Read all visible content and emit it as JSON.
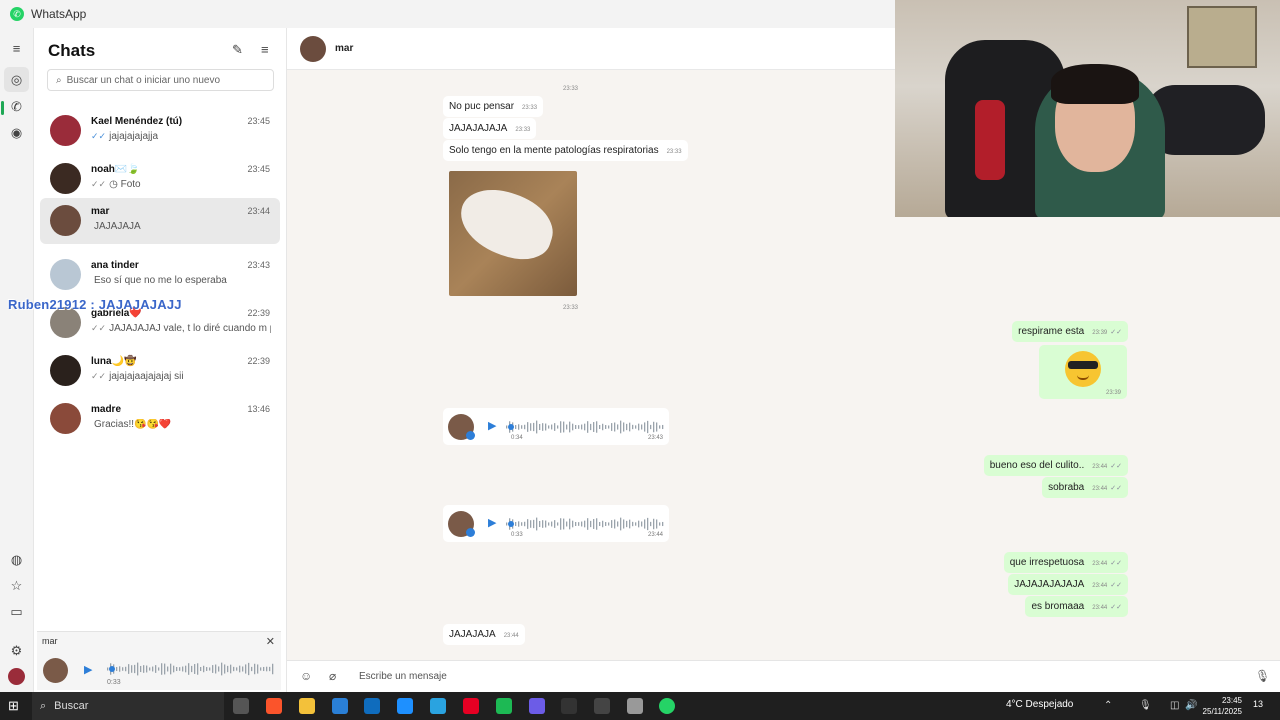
{
  "window": {
    "title": "WhatsApp",
    "logo_glyph": "✆"
  },
  "rail": {
    "icons": [
      "menu-icon",
      "chats-icon",
      "calls-icon",
      "status-icon",
      "communities-icon",
      "starred-icon",
      "archived-icon",
      "settings-icon",
      "profile-avatar"
    ],
    "glyphs": {
      "menu": "≡",
      "chats": "◎",
      "calls": "✆",
      "status": "◉",
      "communities": "◍",
      "starred": "☆",
      "archived": "▭",
      "settings": "⚙"
    },
    "accent": "#1fa855"
  },
  "chat_list": {
    "title": "Chats",
    "new_chat_glyph": "✎",
    "filter_glyph": "≡",
    "search_glyph": "⌕",
    "search_placeholder": "Buscar un chat o iniciar uno nuevo",
    "chats": [
      {
        "name": "Kael Menéndez (tú)",
        "time": "23:45",
        "preview": "jajajajajajja",
        "ticks": "✓✓",
        "avatar_color": "#9a2c3a"
      },
      {
        "name": "noah✉️🍃",
        "time": "23:45",
        "preview": "◷ Foto",
        "ticks": "✓✓",
        "avatar_color": "#3b2a22"
      },
      {
        "name": "mar",
        "time": "23:44",
        "preview": "JAJAJAJA",
        "ticks": "",
        "avatar_color": "#6b4c3e"
      },
      {
        "name": "ana tinder",
        "time": "23:43",
        "preview": "Eso sí que no me lo esperaba",
        "ticks": "",
        "avatar_color": "#b9c7d4"
      },
      {
        "name": "gabriela❤️",
        "time": "22:39",
        "preview": "JAJAJAJAJ vale, t lo diré cuando m p...",
        "ticks": "✓✓",
        "avatar_color": "#8a8278"
      },
      {
        "name": "luna🌙🤠",
        "time": "22:39",
        "preview": "jajajajaajajajaj sii",
        "ticks": "✓✓",
        "avatar_color": "#2a211c"
      },
      {
        "name": "madre",
        "time": "13:46",
        "preview": "Gracias!!😘😘❤️",
        "ticks": "",
        "avatar_color": "#8a4a3a"
      }
    ]
  },
  "overlay_watermark": "Ruben21912 : JAJAJAJAJJ",
  "mini_player": {
    "name": "mar",
    "duration": "0:33",
    "close_glyph": "✕",
    "play_glyph": "▶"
  },
  "conversation": {
    "contact_name": "mar",
    "top_stamp": "23:33",
    "messages": [
      {
        "text": "No puc pensar",
        "time": "23:33",
        "dir": "in"
      },
      {
        "text": "JAJAJAJAJA",
        "time": "23:33",
        "dir": "in"
      },
      {
        "text": "Solo tengo en la mente patologías respiratorias",
        "time": "23:33",
        "dir": "in"
      },
      {
        "text": "respirame esta",
        "time": "23:39",
        "dir": "out"
      },
      {
        "text": "bueno eso del culito..",
        "time": "23:44",
        "dir": "out"
      },
      {
        "text": "sobraba",
        "time": "23:44",
        "dir": "out"
      },
      {
        "text": "que irrespetuosa",
        "time": "23:44",
        "dir": "out"
      },
      {
        "text": "JAJAJAJAJAJA",
        "time": "23:44",
        "dir": "out"
      },
      {
        "text": "es bromaaa",
        "time": "23:44",
        "dir": "out"
      },
      {
        "text": "JAJAJAJA",
        "time": "23:44",
        "dir": "in"
      }
    ],
    "photo_time": "23:33",
    "emoji_time": "23:39",
    "voice_notes": [
      {
        "duration": "0:34",
        "time": "23:43"
      },
      {
        "duration": "0:33",
        "time": "23:44"
      }
    ],
    "read_ticks": "✓✓",
    "play_glyph": "▶"
  },
  "composer": {
    "placeholder": "Escribe un mensaje",
    "emoji_glyph": "☺",
    "attach_glyph": "⌀",
    "mic_glyph": "🎙"
  },
  "taskbar": {
    "start_glyph": "⊞",
    "search_label": "Buscar",
    "search_glyph": "⌕",
    "weather": "4°C  Despejado",
    "time": "23:45",
    "date": "25/11/2025",
    "notifications": "13",
    "apps": [
      {
        "name": "task-view-icon",
        "color": "#555"
      },
      {
        "name": "brave-icon",
        "color": "#fb542b"
      },
      {
        "name": "files-icon",
        "color": "#f3c13a"
      },
      {
        "name": "store-icon",
        "color": "#2a7fd6"
      },
      {
        "name": "outlook-icon",
        "color": "#0f6cbd"
      },
      {
        "name": "photos-icon",
        "color": "#1e90ff"
      },
      {
        "name": "telegram-icon",
        "color": "#2aa3e0"
      },
      {
        "name": "pinterest-icon",
        "color": "#e60023"
      },
      {
        "name": "spotify-icon",
        "color": "#1db954"
      },
      {
        "name": "discord-icon",
        "color": "#6c5ce7"
      },
      {
        "name": "capcut-icon",
        "color": "#333"
      },
      {
        "name": "obs-icon",
        "color": "#444"
      },
      {
        "name": "app-icon",
        "color": "#999"
      },
      {
        "name": "whatsapp-icon",
        "color": "#25d366"
      }
    ]
  }
}
